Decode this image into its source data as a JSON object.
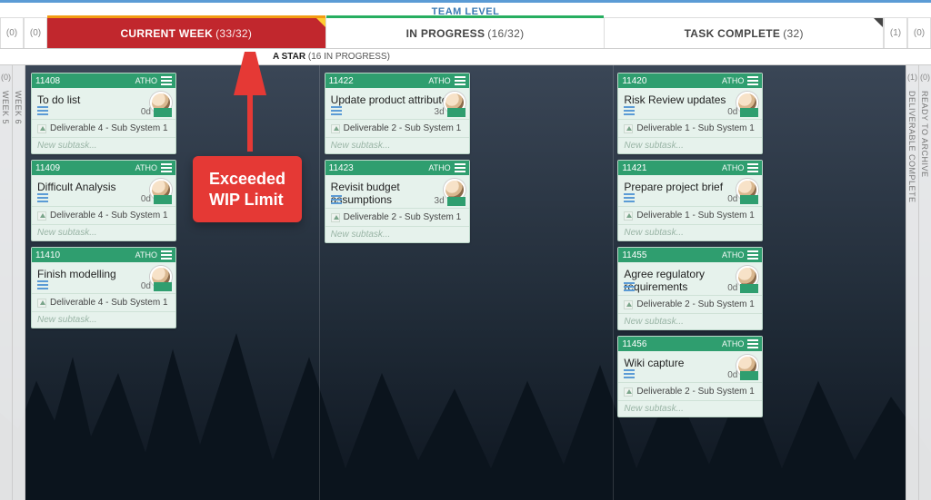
{
  "header": {
    "team_level": "TEAM LEVEL"
  },
  "side_counts": {
    "far_left": "(0)",
    "left": "(0)",
    "right": "(1)",
    "far_right": "(0)"
  },
  "columns": [
    {
      "label": "CURRENT WEEK",
      "count": "(33/32)"
    },
    {
      "label": "IN PROGRESS",
      "count": "(16/32)"
    },
    {
      "label": "TASK COMPLETE",
      "count": "(32)"
    }
  ],
  "swimlane": {
    "name": "A STAR",
    "status": "(16 IN PROGRESS)"
  },
  "left_rails": [
    {
      "count": "(0)",
      "label": "WEEK 5"
    },
    {
      "count": "",
      "label": "WEEK 6"
    }
  ],
  "right_rails": [
    {
      "count": "(1)",
      "label": "DELIVERABLE COMPLETE"
    },
    {
      "count": "(0)",
      "label": "READY TO ARCHIVE"
    }
  ],
  "placeholders": {
    "new_subtask": "New subtask..."
  },
  "assignee_tag": "ATHO",
  "lanes": {
    "current": [
      {
        "id": "11408",
        "title": "To do list",
        "dur": "0d",
        "meta": "Deliverable 4 - Sub System 1"
      },
      {
        "id": "11409",
        "title": "Difficult Analysis",
        "dur": "0d",
        "meta": "Deliverable 4 - Sub System 1"
      },
      {
        "id": "11410",
        "title": "Finish modelling",
        "dur": "0d",
        "meta": "Deliverable 4 - Sub System 1"
      }
    ],
    "progress": [
      {
        "id": "11422",
        "title": "Update product attributes",
        "dur": "3d",
        "meta": "Deliverable 2 - Sub System 1"
      },
      {
        "id": "11423",
        "title": "Revisit budget assumptions",
        "dur": "3d",
        "meta": "Deliverable 2 - Sub System 1"
      }
    ],
    "complete": [
      {
        "id": "11420",
        "title": "Risk Review updates",
        "dur": "0d",
        "meta": "Deliverable 1 - Sub System 1"
      },
      {
        "id": "11421",
        "title": "Prepare project brief",
        "dur": "0d",
        "meta": "Deliverable 1 - Sub System 1"
      },
      {
        "id": "11455",
        "title": "Agree regulatory requirements",
        "dur": "0d",
        "meta": "Deliverable 2 - Sub System 1"
      },
      {
        "id": "11456",
        "title": "Wiki capture",
        "dur": "0d",
        "meta": "Deliverable 2 - Sub System 1"
      }
    ]
  },
  "annotation": {
    "line1": "Exceeded",
    "line2": "WIP Limit"
  }
}
